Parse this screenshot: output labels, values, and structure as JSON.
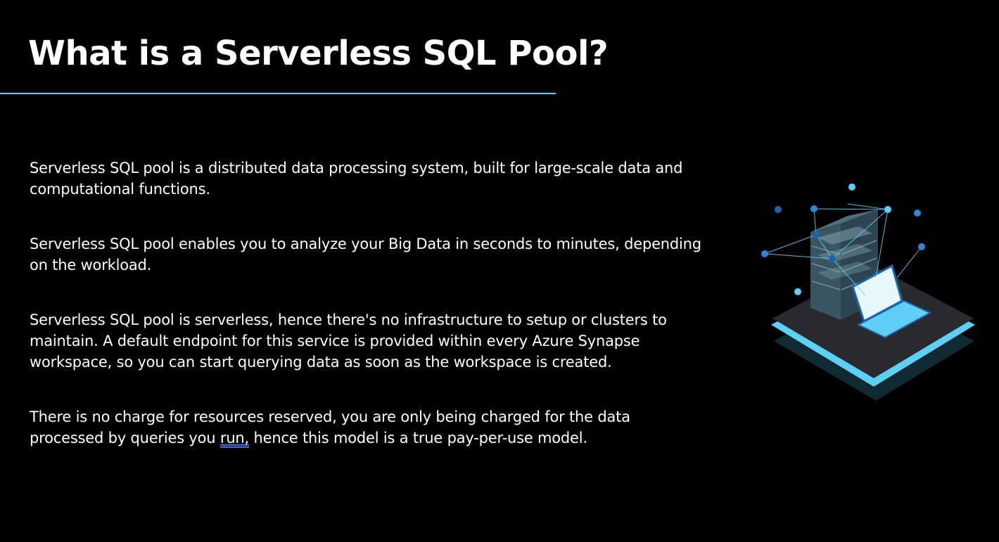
{
  "slide": {
    "title": "What is a Serverless SQL Pool?",
    "paragraphs": [
      "Serverless SQL pool is a distributed data processing system, built for large-scale data and computational functions.",
      "Serverless SQL pool enables you to analyze your Big Data in seconds to minutes, depending on the workload.",
      "Serverless SQL pool is serverless, hence there's no infrastructure to setup or clusters to maintain. A default endpoint for this service is provided within every Azure Synapse workspace, so you can start querying data as soon as the workspace is created."
    ],
    "last_paragraph": {
      "before": "There is no charge for resources reserved, you are only being charged for the data processed by queries you ",
      "flagged_word": "run,",
      "after": " hence this model is a true pay-per-use model."
    }
  },
  "illustration": {
    "name": "server-network-laptop-icon",
    "colors": {
      "accent": "#5fd0f5",
      "platform": "#2a2a2e",
      "server": "#3a5560",
      "node_dark": "#1e63b0",
      "node_light": "#5fd0f5"
    }
  }
}
